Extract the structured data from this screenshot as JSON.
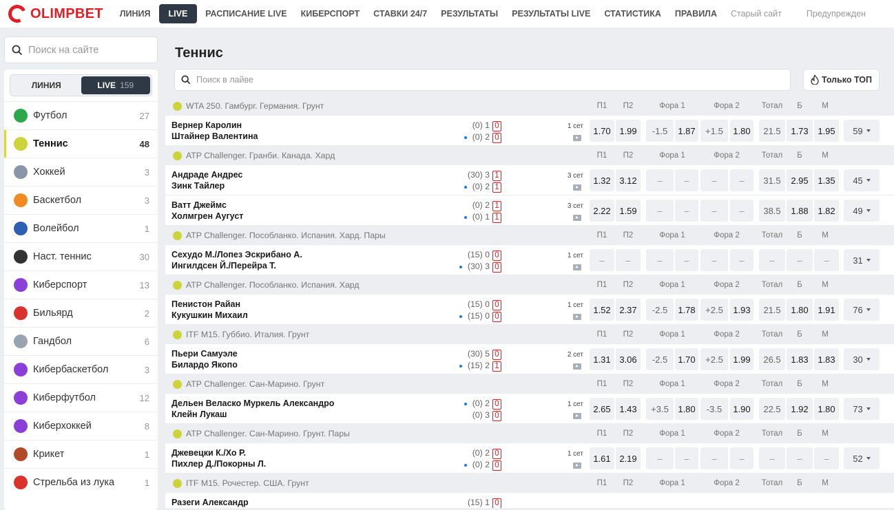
{
  "brand": {
    "logo_text": "OLIMPBET",
    "accent": "#e01e25",
    "dark": "#2e3945"
  },
  "nav": {
    "items": [
      "ЛИНИЯ",
      "LIVE",
      "РАСПИСАНИЕ LIVE",
      "КИБЕРСПОРТ",
      "СТАВКИ 24/7",
      "РЕЗУЛЬТАТЫ",
      "РЕЗУЛЬТАТЫ LIVE",
      "СТАТИСТИКА",
      "ПРАВИЛА"
    ],
    "active": "LIVE",
    "old_site": "Старый сайт",
    "warning": "Предупрежден"
  },
  "sidebar": {
    "search_placeholder": "Поиск на сайте",
    "toggle": {
      "line": "ЛИНИЯ",
      "live": "LIVE",
      "live_count": "159"
    },
    "sports": [
      {
        "name": "Футбол",
        "count": "27",
        "icon": "football-icon",
        "color": "#2aa84a"
      },
      {
        "name": "Теннис",
        "count": "48",
        "icon": "tennis-icon",
        "color": "#cbd43a",
        "active": true
      },
      {
        "name": "Хоккей",
        "count": "3",
        "icon": "hockey-icon",
        "color": "#8a96a8"
      },
      {
        "name": "Баскетбол",
        "count": "3",
        "icon": "basketball-icon",
        "color": "#f08a24"
      },
      {
        "name": "Волейбол",
        "count": "1",
        "icon": "volleyball-icon",
        "color": "#2f5fb3"
      },
      {
        "name": "Наст. теннис",
        "count": "30",
        "icon": "table-tennis-icon",
        "color": "#333333"
      },
      {
        "name": "Киберспорт",
        "count": "13",
        "icon": "gamepad-icon",
        "color": "#8b3fd6"
      },
      {
        "name": "Бильярд",
        "count": "2",
        "icon": "billiards-icon",
        "color": "#d9342b"
      },
      {
        "name": "Гандбол",
        "count": "6",
        "icon": "handball-icon",
        "color": "#9aa3b0"
      },
      {
        "name": "Кибербаскетбол",
        "count": "3",
        "icon": "cyber-basketball-icon",
        "color": "#8b3fd6"
      },
      {
        "name": "Киберфутбол",
        "count": "12",
        "icon": "cyber-football-icon",
        "color": "#8b3fd6"
      },
      {
        "name": "Киберхоккей",
        "count": "8",
        "icon": "cyber-hockey-icon",
        "color": "#8b3fd6"
      },
      {
        "name": "Крикет",
        "count": "1",
        "icon": "cricket-icon",
        "color": "#b04a2a"
      },
      {
        "name": "Стрельба из лука",
        "count": "1",
        "icon": "archery-icon",
        "color": "#d9342b"
      }
    ]
  },
  "main": {
    "title": "Теннис",
    "search_placeholder": "Поиск в лайве",
    "top_button": "Только ТОП",
    "columns": [
      "П1",
      "П2",
      "Фора 1",
      "Фора 2",
      "Тотал",
      "Б",
      "М"
    ],
    "leagues": [
      {
        "name": "WTA 250. Гамбург. Германия. Грунт",
        "matches": [
          {
            "p1": "Вернер Каролин",
            "p2": "Штайнер Валентина",
            "s1": [
              "(0)",
              "1",
              "0"
            ],
            "s2": [
              "(0)",
              "2",
              "0"
            ],
            "serve": 2,
            "set": "1 сет",
            "odds": [
              "1.70",
              "1.99",
              [
                "-1.5",
                "1.87"
              ],
              [
                "+1.5",
                "1.80"
              ],
              "21.5",
              "1.73",
              "1.95"
            ],
            "more": "59"
          }
        ]
      },
      {
        "name": "ATP Challenger. Гранби. Канада. Хард",
        "matches": [
          {
            "p1": "Андраде Андрес",
            "p2": "Зинк Тайлер",
            "s1": [
              "(30)",
              "3",
              "1"
            ],
            "s2": [
              "(0)",
              "2",
              "1"
            ],
            "serve": 2,
            "set": "3 сет",
            "odds": [
              "1.32",
              "3.12",
              [
                "–",
                "–"
              ],
              [
                "–",
                "–"
              ],
              "31.5",
              "2.95",
              "1.35"
            ],
            "more": "45"
          },
          {
            "p1": "Ватт Джеймс",
            "p2": "Холмгрен Аугуст",
            "s1": [
              "(0)",
              "2",
              "1"
            ],
            "s2": [
              "(0)",
              "1",
              "1"
            ],
            "serve": 2,
            "set": "3 сет",
            "odds": [
              "2.22",
              "1.59",
              [
                "–",
                "–"
              ],
              [
                "–",
                "–"
              ],
              "38.5",
              "1.88",
              "1.82"
            ],
            "more": "49"
          }
        ]
      },
      {
        "name": "ATP Challenger. Пособланко. Испания. Хард. Пары",
        "matches": [
          {
            "p1": "Сехудо М./Лопез Эскрибано А.",
            "p2": "Ингилдсен Й./Перейра Т.",
            "s1": [
              "(15)",
              "0",
              "0"
            ],
            "s2": [
              "(30)",
              "3",
              "0"
            ],
            "serve": 2,
            "set": "1 сет",
            "odds": [
              "–",
              "–",
              [
                "–",
                "–"
              ],
              [
                "–",
                "–"
              ],
              "–",
              "–",
              "–"
            ],
            "more": "31"
          }
        ]
      },
      {
        "name": "ATP Challenger. Пособланко. Испания. Хард",
        "matches": [
          {
            "p1": "Пенистон Райан",
            "p2": "Кукушкин Михаил",
            "s1": [
              "(15)",
              "0",
              "0"
            ],
            "s2": [
              "(15)",
              "0",
              "0"
            ],
            "serve": 2,
            "set": "1 сет",
            "odds": [
              "1.52",
              "2.37",
              [
                "-2.5",
                "1.78"
              ],
              [
                "+2.5",
                "1.93"
              ],
              "21.5",
              "1.80",
              "1.91"
            ],
            "more": "76"
          }
        ]
      },
      {
        "name": "ITF M15. Губбио. Италия. Грунт",
        "matches": [
          {
            "p1": "Пьери Самуэле",
            "p2": "Билардо Якопо",
            "s1": [
              "(30)",
              "5",
              "0"
            ],
            "s2": [
              "(15)",
              "2",
              "1"
            ],
            "serve": 2,
            "set": "2 сет",
            "odds": [
              "1.31",
              "3.06",
              [
                "-2.5",
                "1.70"
              ],
              [
                "+2.5",
                "1.99"
              ],
              "26.5",
              "1.83",
              "1.83"
            ],
            "more": "30"
          }
        ]
      },
      {
        "name": "ATP Challenger. Сан-Марино. Грунт",
        "matches": [
          {
            "p1": "Дельен Веласко Муркель Александро",
            "p2": "Клейн Лукаш",
            "s1": [
              "(0)",
              "2",
              "0"
            ],
            "s2": [
              "(0)",
              "3",
              "0"
            ],
            "serve": 1,
            "set": "1 сет",
            "odds": [
              "2.65",
              "1.43",
              [
                "+3.5",
                "1.80"
              ],
              [
                "-3.5",
                "1.90"
              ],
              "22.5",
              "1.92",
              "1.80"
            ],
            "more": "73"
          }
        ]
      },
      {
        "name": "ATP Challenger. Сан-Марино. Грунт. Пары",
        "matches": [
          {
            "p1": "Джевецки К./Хо Р.",
            "p2": "Пихлер Д./Покорны Л.",
            "s1": [
              "(0)",
              "2",
              "0"
            ],
            "s2": [
              "(0)",
              "2",
              "0"
            ],
            "serve": 2,
            "set": "1 сет",
            "odds": [
              "1.61",
              "2.19",
              [
                "–",
                "–"
              ],
              [
                "–",
                "–"
              ],
              "–",
              "–",
              "–"
            ],
            "more": "52"
          }
        ]
      },
      {
        "name": "ITF M15. Рочестер. США. Грунт",
        "matches": [
          {
            "p1": "Разеги Александр",
            "p2": "",
            "s1": [
              "(15)",
              "1",
              "0"
            ],
            "s2": [
              "",
              "",
              ""
            ],
            "serve": 0,
            "set": "",
            "odds": [
              "",
              "",
              [
                "",
                ""
              ],
              [
                "",
                ""
              ],
              "",
              "",
              ""
            ],
            "more": ""
          }
        ]
      }
    ]
  }
}
